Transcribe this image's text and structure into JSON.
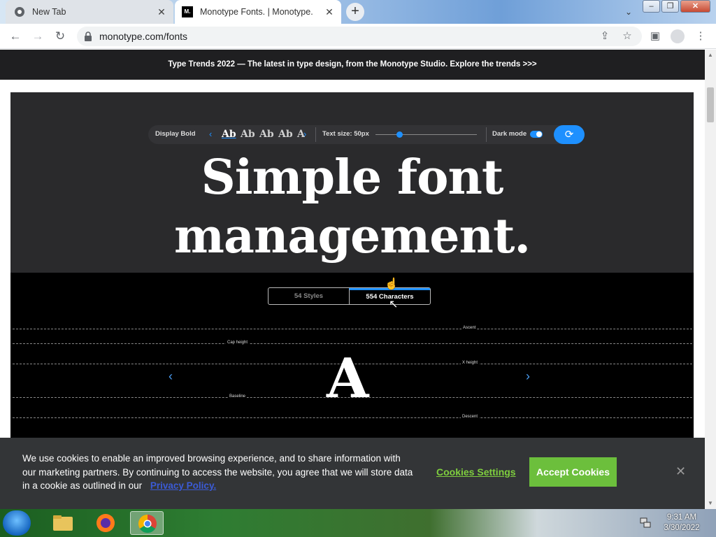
{
  "browser": {
    "tabs": [
      {
        "title": "New Tab",
        "icon": "chrome-icon"
      },
      {
        "title": "Monotype Fonts. | Monotype.",
        "icon": "monotype-favicon",
        "favicon_text": "M."
      }
    ],
    "url": "monotype.com/fonts"
  },
  "page": {
    "promo": "Type Trends 2022 — The latest in type design, from the Monotype Studio. Explore the trends >>>",
    "tester": {
      "font_name": "Display Bold",
      "samples": [
        "Ab",
        "Ab",
        "Ab",
        "Ab",
        "A"
      ],
      "text_size_label": "Text size: 50px",
      "dark_mode_label": "Dark mode",
      "dark_mode_on": true
    },
    "headline_line1": "Simple font",
    "headline_line2": "management.",
    "segments": [
      "54 Styles",
      "554 Characters"
    ],
    "active_segment": "554 Characters",
    "guides": {
      "ascent": "Ascent",
      "cap_height": "Cap height",
      "x_height": "X height",
      "baseline": "Baseline",
      "descent": "Descent"
    },
    "glyph": "A"
  },
  "cookie": {
    "text": "We use cookies to enable an improved browsing experience, and to share information with our marketing partners. By continuing to access the website, you agree that we will store data in a cookie as outlined in our",
    "policy_link": "Privacy Policy.",
    "settings": "Cookies Settings",
    "accept": "Accept Cookies"
  },
  "taskbar": {
    "time": "9:31 AM",
    "date": "3/30/2022"
  },
  "colors": {
    "accent": "#1e90ff",
    "accept": "#6cbf3c",
    "hero_bg": "#2a2a2c"
  }
}
